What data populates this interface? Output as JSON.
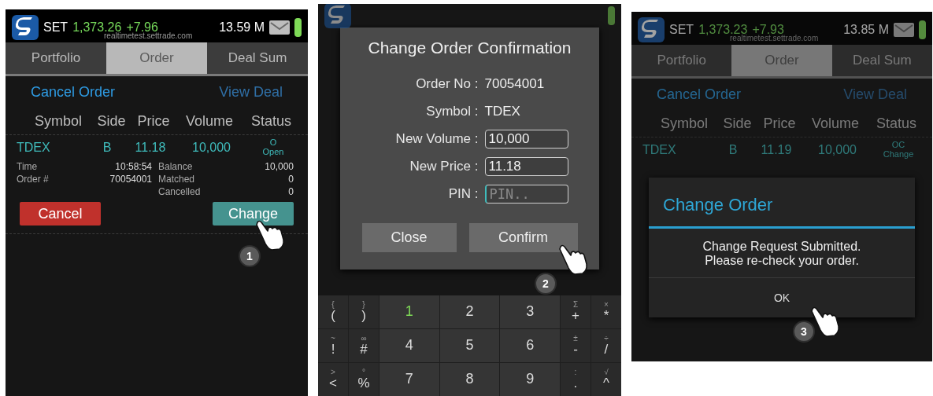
{
  "order_screen": {
    "header": {
      "index_name": "SET",
      "index_value": "1,373.26",
      "index_change": "+7.96",
      "volume": "13.59 M",
      "server": "realtimetest.settrade.com"
    },
    "tabs": [
      {
        "label": "Portfolio",
        "selected": false
      },
      {
        "label": "Order",
        "selected": true
      },
      {
        "label": "Deal Sum",
        "selected": false
      }
    ],
    "links": [
      {
        "label": "Cancel Order",
        "disabled": false
      },
      {
        "label": "View Deal",
        "disabled": true
      }
    ],
    "columns": [
      "Symbol",
      "Side",
      "Price",
      "Volume",
      "Status"
    ],
    "order": {
      "symbol": "TDEX",
      "side": "B",
      "price": "11.18",
      "volume": "10,000",
      "status_code": "O",
      "status": "Open"
    },
    "details_left": [
      {
        "label": "Time",
        "value": "10:58:54"
      },
      {
        "label": "Order #",
        "value": "70054001"
      }
    ],
    "details_right": [
      {
        "label": "Balance",
        "value": "10,000"
      },
      {
        "label": "Matched",
        "value": "0"
      },
      {
        "label": "Cancelled",
        "value": "0"
      }
    ],
    "buttons": [
      {
        "label": "Cancel",
        "kind": "danger"
      },
      {
        "label": "Change",
        "kind": "primary"
      }
    ],
    "step": "1"
  },
  "confirm_screen": {
    "dialog": {
      "title": "Change Order Confirmation",
      "fields": [
        {
          "label": "Order No :",
          "value": "70054001",
          "kind": "text"
        },
        {
          "label": "Symbol :",
          "value": "TDEX",
          "kind": "text"
        },
        {
          "label": "New Volume :",
          "value": "10,000",
          "kind": "input"
        },
        {
          "label": "New Price :",
          "value": "11.18",
          "kind": "input"
        },
        {
          "label": "PIN :",
          "placeholder": "PIN..",
          "kind": "input"
        }
      ],
      "buttons": [
        "Close",
        "Confirm"
      ]
    },
    "keypad": [
      [
        {
          "top": "{",
          "main": "(",
          "kind": "symbol",
          "highlighted": false
        },
        {
          "top": "}",
          "main": ")",
          "kind": "symbol",
          "highlighted": false
        },
        {
          "main": "1",
          "kind": "digit",
          "highlighted": true
        },
        {
          "main": "2",
          "kind": "digit",
          "highlighted": false
        },
        {
          "main": "3",
          "kind": "digit",
          "highlighted": false
        },
        {
          "top": "Σ",
          "main": "+",
          "kind": "symbol",
          "highlighted": false
        },
        {
          "top": "×",
          "main": "*",
          "kind": "symbol",
          "highlighted": false
        }
      ],
      [
        {
          "top": "~",
          "main": "!",
          "kind": "symbol",
          "highlighted": false
        },
        {
          "top": "∞",
          "main": "#",
          "kind": "symbol",
          "highlighted": false
        },
        {
          "main": "4",
          "kind": "digit",
          "highlighted": false
        },
        {
          "main": "5",
          "kind": "digit",
          "highlighted": false
        },
        {
          "main": "6",
          "kind": "digit",
          "highlighted": false
        },
        {
          "top": "±",
          "main": "-",
          "kind": "symbol",
          "highlighted": false
        },
        {
          "top": "÷",
          "main": "/",
          "kind": "symbol",
          "highlighted": false
        }
      ],
      [
        {
          "top": ">",
          "main": "<",
          "kind": "symbol",
          "highlighted": false
        },
        {
          "top": "°",
          "main": "%",
          "kind": "symbol",
          "highlighted": false
        },
        {
          "main": "7",
          "kind": "digit",
          "highlighted": false
        },
        {
          "main": "8",
          "kind": "digit",
          "highlighted": false
        },
        {
          "main": "9",
          "kind": "digit",
          "highlighted": false
        },
        {
          "top": ":",
          "main": ".",
          "kind": "symbol",
          "highlighted": false
        },
        {
          "top": "√",
          "main": "^",
          "kind": "symbol",
          "highlighted": false
        }
      ]
    ],
    "step": "2"
  },
  "result_screen": {
    "header": {
      "index_name": "SET",
      "index_value": "1,373.23",
      "index_change": "+7.93",
      "volume": "13.85 M",
      "server": "realtimetest.settrade.com"
    },
    "tabs": [
      {
        "label": "Portfolio",
        "selected": false
      },
      {
        "label": "Order",
        "selected": true
      },
      {
        "label": "Deal Sum",
        "selected": false
      }
    ],
    "links": [
      {
        "label": "Cancel Order",
        "disabled": false
      },
      {
        "label": "View Deal",
        "disabled": true
      }
    ],
    "columns": [
      "Symbol",
      "Side",
      "Price",
      "Volume",
      "Status"
    ],
    "order": {
      "symbol": "TDEX",
      "side": "B",
      "price": "11.19",
      "volume": "10,000",
      "status_code": "OC",
      "status": "Change"
    },
    "dialog": {
      "title": "Change Order",
      "message": [
        "Change Request Submitted.",
        "Please re-check your order."
      ],
      "button": "OK"
    },
    "step": "3"
  }
}
